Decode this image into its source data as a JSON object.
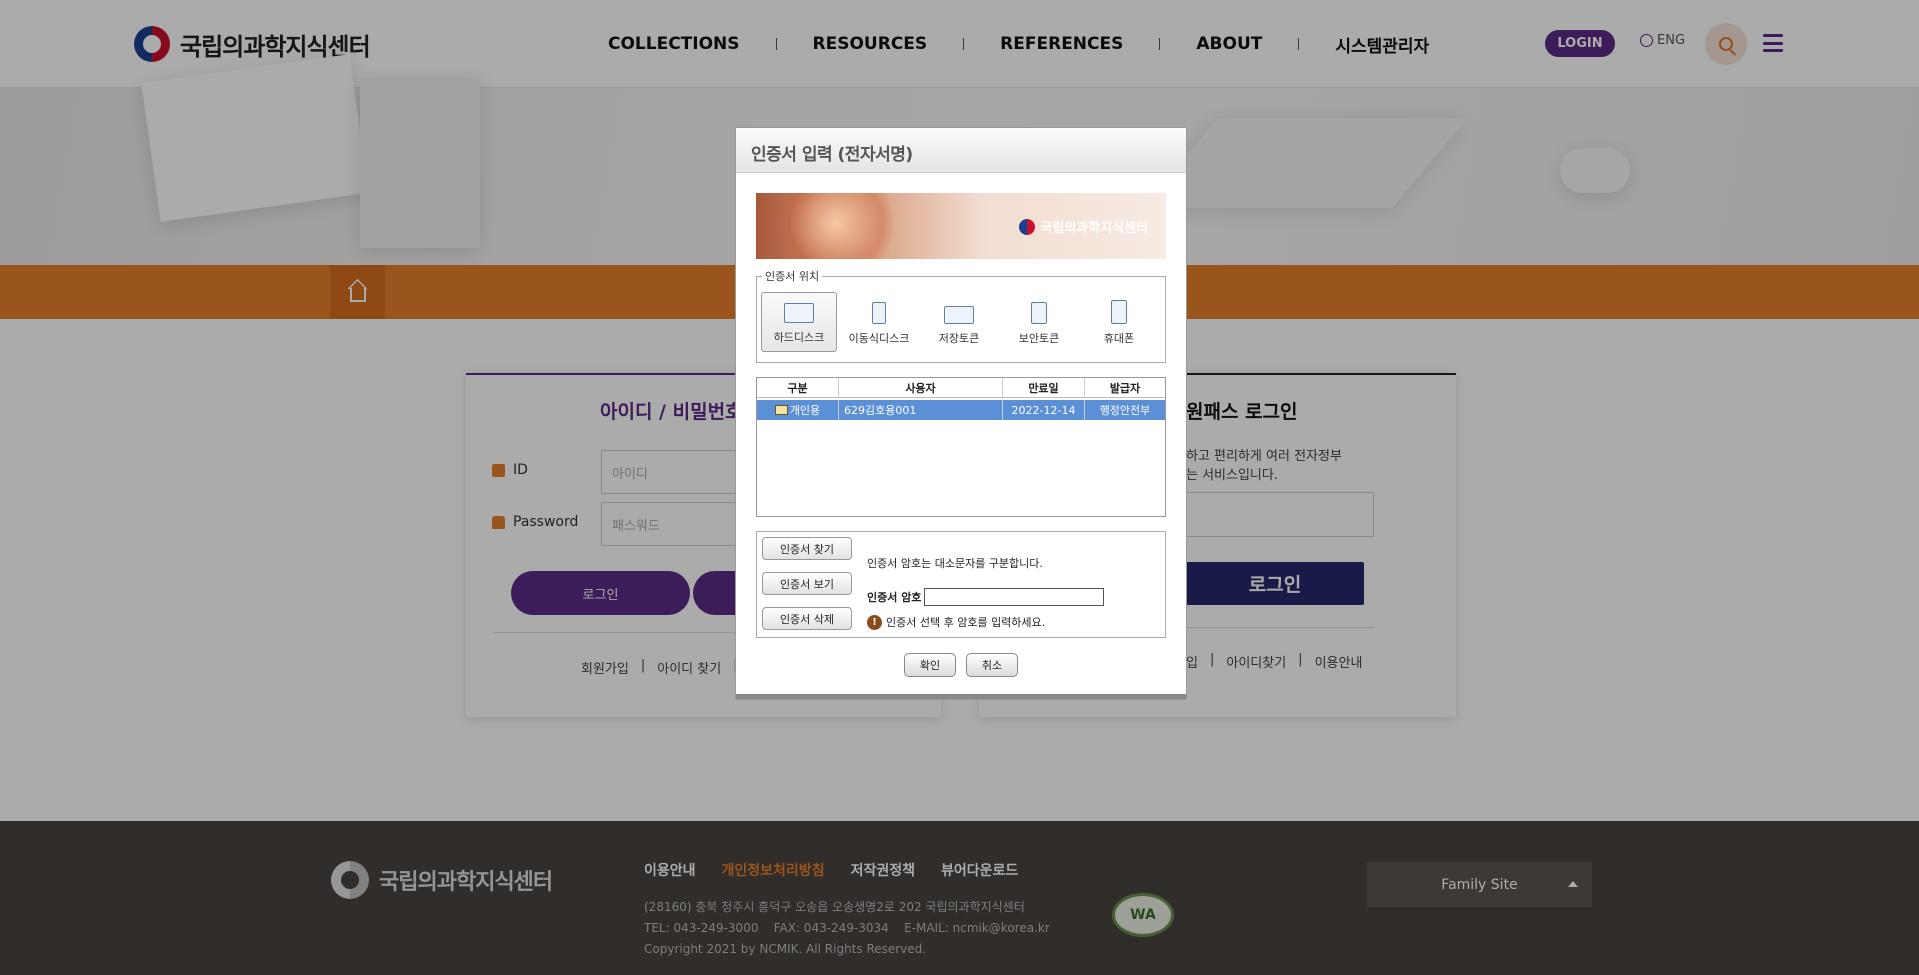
{
  "header": {
    "logo_text": "국립의과학지식센터",
    "nav": [
      "COLLECTIONS",
      "RESOURCES",
      "REFERENCES",
      "ABOUT",
      "시스템관리자"
    ],
    "login_label": "LOGIN",
    "lang_label": "ENG"
  },
  "left_panel": {
    "title": "아이디 / 비밀번호",
    "id_label": "ID",
    "id_placeholder": "아이디",
    "pw_label": "Password",
    "pw_placeholder": "패스워드",
    "login_button": "로그인",
    "links": [
      "회원가입",
      "|",
      "아이디 찾기",
      "|"
    ]
  },
  "right_panel": {
    "title": "원패스 로그인",
    "desc_line1": "하고 편리하게 여러 전자정부",
    "desc_line2": "는 서비스입니다.",
    "login_button": "로그인",
    "links": [
      "입",
      "|",
      "아이디찾기",
      "|",
      "이용안내"
    ]
  },
  "dialog": {
    "title": "인증서 입력 (전자서명)",
    "banner_logo": "국립의과학지식센터",
    "location_legend": "인증서 위치",
    "locations": [
      "하드디스크",
      "이동식디스크",
      "저장토큰",
      "보안토큰",
      "휴대폰"
    ],
    "table_headers": [
      "구분",
      "사용자",
      "만료일",
      "발급자"
    ],
    "selected_cert": {
      "type": "개인용",
      "user": "629김호용001",
      "expires": "2022-12-14",
      "issuer": "행정안전부"
    },
    "find_button": "인증서 찾기",
    "view_button": "인증서 보기",
    "delete_button": "인증서 삭제",
    "case_note": "인증서 암호는 대소문자를 구분합니다.",
    "password_label": "인증서 암호",
    "warning": "인증서 선택 후 암호를 입력하세요.",
    "ok_button": "확인",
    "cancel_button": "취소"
  },
  "footer": {
    "logo_text": "국립의과학지식센터",
    "links": [
      "이용안내",
      "개인정보처리방침",
      "저작권정책",
      "뷰어다운로드"
    ],
    "address": "(28160) 충북 청주시 흥덕구 오송읍 오송생명2로 202 국립의과학지식센터",
    "contact": "TEL: 043-249-3000    FAX: 043-249-3034    E-MAIL: ncmik@korea.kr",
    "copyright": "Copyright 2021 by NCMIK. All Rights Reserved.",
    "badge": "WA",
    "family_site": "Family Site"
  },
  "colors": {
    "brand_purple": "#5b2a86",
    "accent_orange": "#e57f2a",
    "footer_bg": "#4a433f",
    "selection_blue": "#5b8fd6"
  },
  "icons": [
    "home-icon",
    "search-icon",
    "menu-icon",
    "globe-icon",
    "id-icon",
    "lock-icon",
    "monitor-icon",
    "usb-icon",
    "token-icon",
    "secure-token-icon",
    "phone-icon",
    "warning-icon"
  ]
}
